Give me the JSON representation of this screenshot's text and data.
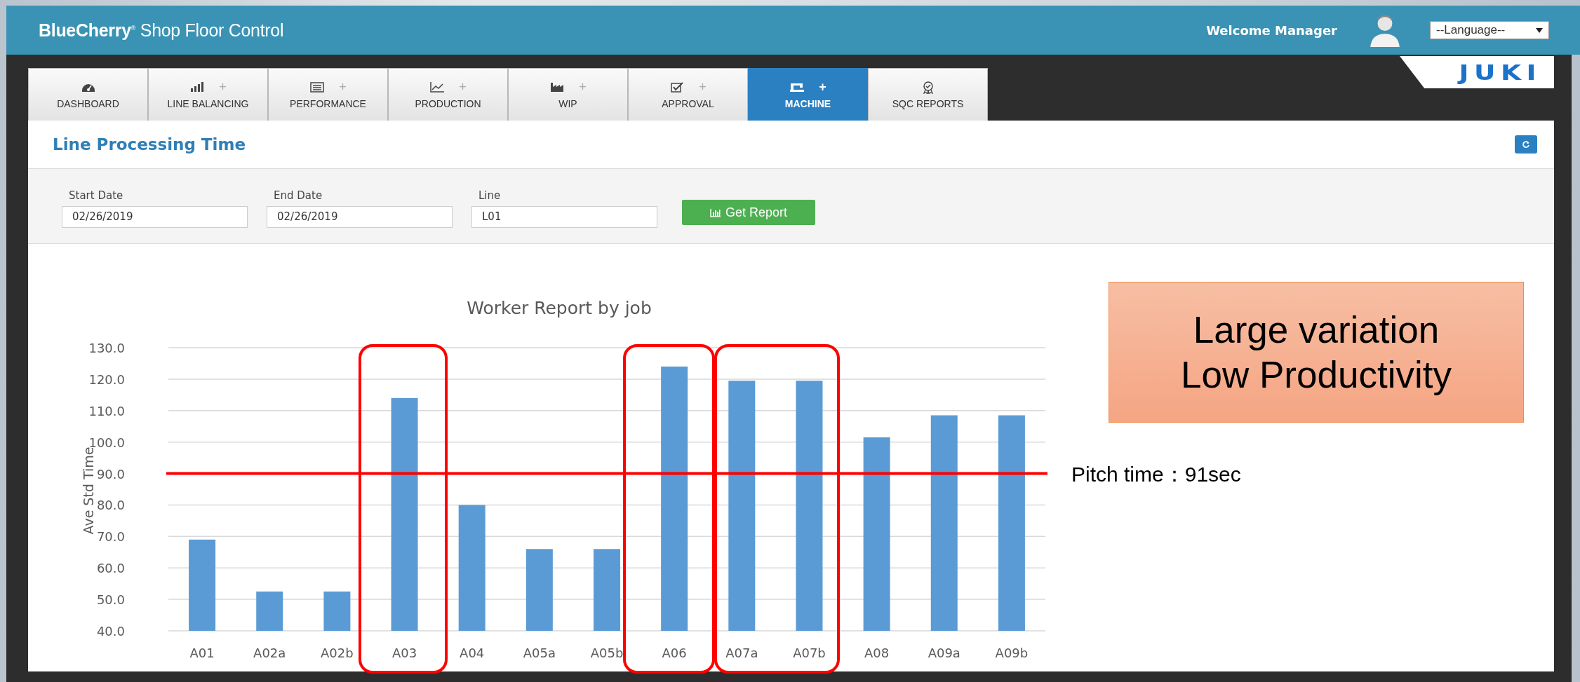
{
  "header": {
    "brand": "**BlueCherry**$^{®}$ Shop Floor Control",
    "welcome": "Welcome Manager",
    "language": "--Language--",
    "logo": "JUKI"
  },
  "tabs": [
    {
      "label": "DASHBOARD",
      "selected": false
    },
    {
      "label": "LINE BALANCING",
      "plus": "+",
      "selected": false
    },
    {
      "label": "PERFORMANCE",
      "plus": "+",
      "selected": false
    },
    {
      "label": "PRODUCTION",
      "plus": "+",
      "selected": false
    },
    {
      "label": "WIP",
      "plus": "+",
      "selected": false
    },
    {
      "label": "APPROVAL",
      "plus": "+",
      "selected": false
    },
    {
      "label": "MACHINE",
      "plus": "+",
      "selected": true
    },
    {
      "label": "SQC REPORTS",
      "selected": false
    }
  ],
  "panel": {
    "title": "Line Processing Time",
    "filters": [
      {
        "label": "Start Date",
        "value": "02/26/2019"
      },
      {
        "label": "End Date",
        "value": "02/26/2019"
      },
      {
        "label": "Line",
        "value": "L01"
      }
    ],
    "button": "Get Report",
    "chart_data": {
      "type": "bar",
      "title": "Worker Report by job",
      "ylabel": "Ave Std Time",
      "categories": [
        "A01",
        "A02a",
        "A02b",
        "A03",
        "A04",
        "A05a",
        "A05b",
        "A06",
        "A07a",
        "A07b",
        "A08",
        "A09a",
        "A09b"
      ],
      "series": [
        {
          "color": "#5b9bd5",
          "values": [
            69,
            52.5,
            52.5,
            114,
            80,
            66,
            66,
            124,
            119.5,
            119.5,
            101.5,
            108.5,
            108.5
          ]
        }
      ],
      "grid": true,
      "ylim": [
        40,
        130
      ],
      "yticks": [
        {
          "value": 40,
          "label": "40.0"
        },
        {
          "value": 50,
          "label": "50.0"
        },
        {
          "value": 60,
          "label": "60.0"
        },
        {
          "value": 70,
          "label": "70.0"
        },
        {
          "value": 80,
          "label": "80.0"
        },
        {
          "value": 90,
          "label": "90.0"
        },
        {
          "value": 100,
          "label": "100.0"
        },
        {
          "value": 110,
          "label": "110.0"
        },
        {
          "value": 120,
          "label": "120.0"
        },
        {
          "value": 130,
          "label": "130.0"
        }
      ]
    },
    "pitch_label": "Pitch time：91sec",
    "callout": [
      "Large variation",
      "Low Productivity"
    ]
  }
}
